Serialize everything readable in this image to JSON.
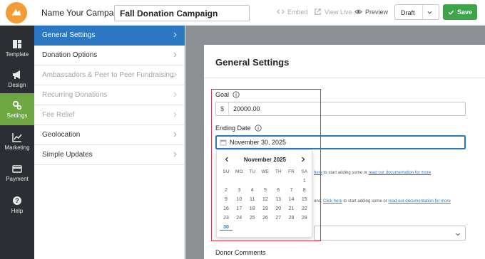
{
  "header": {
    "campaign_label": "Name Your Campaign:",
    "campaign_name": "Fall Donation Campaign",
    "embed": "Embed",
    "view_live": "View Live",
    "preview": "Preview",
    "status_select": "Draft",
    "save": "Save"
  },
  "iconbar": {
    "items": [
      {
        "label": "Template",
        "icon": "template-icon"
      },
      {
        "label": "Design",
        "icon": "megaphone-icon"
      },
      {
        "label": "Settings",
        "icon": "gears-icon",
        "active": true
      },
      {
        "label": "Marketing",
        "icon": "chart-icon"
      },
      {
        "label": "Payment",
        "icon": "card-icon"
      },
      {
        "label": "Help",
        "icon": "help-icon"
      }
    ]
  },
  "menu": {
    "items": [
      {
        "label": "General Settings",
        "state": "active"
      },
      {
        "label": "Donation Options",
        "state": "normal"
      },
      {
        "label": "Ambassadors & Peer to Peer Fundraising",
        "state": "disabled"
      },
      {
        "label": "Recurring Donations",
        "state": "disabled"
      },
      {
        "label": "Fee Relief",
        "state": "disabled"
      },
      {
        "label": "Geolocation",
        "state": "normal"
      },
      {
        "label": "Simple Updates",
        "state": "normal"
      }
    ]
  },
  "panel": {
    "title": "General Settings",
    "goal_label": "Goal",
    "goal_prefix": "$",
    "goal_value": "20000.00",
    "ending_date_label": "Ending Date",
    "ending_date_value": "November 30, 2025",
    "donor_comments_label": "Donor Comments",
    "bg_line1_link": "here",
    "bg_line1_text": " to start adding some or ",
    "bg_line1_link2": "read our documentation for more",
    "bg_line2_prefix": "ons. ",
    "bg_line2_link": "Click here",
    "bg_line2_text": " to start adding some or ",
    "bg_line2_link2": "read our documentation for more"
  },
  "calendar": {
    "month": "November 2025",
    "weekdays": [
      "SU",
      "MO",
      "TU",
      "WE",
      "TH",
      "FR",
      "SA"
    ],
    "weeks": [
      [
        "",
        "",
        "",
        "",
        "",
        "",
        "1"
      ],
      [
        "2",
        "3",
        "4",
        "5",
        "6",
        "7",
        "8"
      ],
      [
        "9",
        "10",
        "11",
        "12",
        "13",
        "14",
        "15"
      ],
      [
        "16",
        "17",
        "18",
        "19",
        "20",
        "21",
        "22"
      ],
      [
        "23",
        "24",
        "25",
        "26",
        "27",
        "28",
        "29"
      ],
      [
        "30",
        "",
        "",
        "",
        "",
        "",
        ""
      ]
    ],
    "selected_day": "30",
    "accent_color": "#2b77c2"
  },
  "colors": {
    "save_button": "#3ea44a",
    "active_sidebar": "#6fa843",
    "active_menu": "#2b77c2",
    "highlight_box": "#d33a4c"
  }
}
